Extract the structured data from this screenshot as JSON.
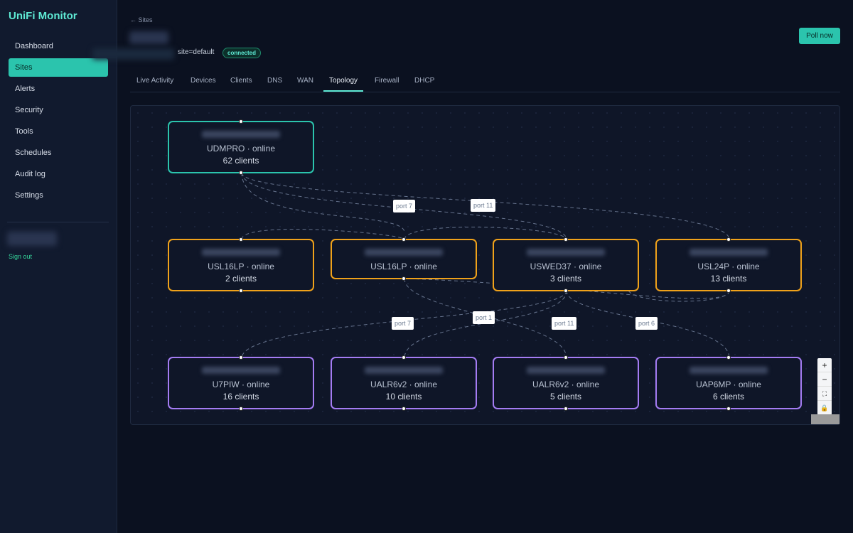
{
  "app": {
    "title": "UniFi Monitor"
  },
  "sidebar": {
    "items": [
      {
        "label": "Dashboard"
      },
      {
        "label": "Sites"
      },
      {
        "label": "Alerts"
      },
      {
        "label": "Security"
      },
      {
        "label": "Tools"
      },
      {
        "label": "Schedules"
      },
      {
        "label": "Audit log"
      },
      {
        "label": "Settings"
      }
    ],
    "active": "Sites",
    "signout_label": "Sign out"
  },
  "header": {
    "breadcrumb": "← Sites",
    "site_label": "site=default",
    "status": "connected",
    "poll_label": "Poll now"
  },
  "tabs": [
    {
      "label": "Live Activity"
    },
    {
      "label": "Devices"
    },
    {
      "label": "Clients"
    },
    {
      "label": "DNS"
    },
    {
      "label": "WAN"
    },
    {
      "label": "Topology"
    },
    {
      "label": "Firewall"
    },
    {
      "label": "DHCP"
    }
  ],
  "active_tab": "Topology",
  "topology": {
    "nodes": [
      {
        "model": "UDMPRO · online",
        "clients": "62 clients",
        "kind": "gateway"
      },
      {
        "model": "USL16LP · online",
        "clients": "2 clients",
        "kind": "switch"
      },
      {
        "model": "USL16LP · online",
        "clients": "",
        "kind": "switch"
      },
      {
        "model": "USWED37 · online",
        "clients": "3 clients",
        "kind": "switch"
      },
      {
        "model": "USL24P · online",
        "clients": "13 clients",
        "kind": "switch"
      },
      {
        "model": "U7PIW · online",
        "clients": "16 clients",
        "kind": "ap"
      },
      {
        "model": "UALR6v2 · online",
        "clients": "10 clients",
        "kind": "ap"
      },
      {
        "model": "UALR6v2 · online",
        "clients": "5 clients",
        "kind": "ap"
      },
      {
        "model": "UAP6MP · online",
        "clients": "6 clients",
        "kind": "ap"
      }
    ],
    "edge_labels": [
      "port 7",
      "port 11",
      "port 7",
      "port 1",
      "port 11",
      "port 6"
    ]
  },
  "zoom": {
    "plus": "+",
    "minus": "−",
    "fit": "⛶",
    "lock": "🔒"
  },
  "colors": {
    "accent": "#2bc4ad",
    "switch": "#f0a21a",
    "ap": "#a47cf3"
  }
}
